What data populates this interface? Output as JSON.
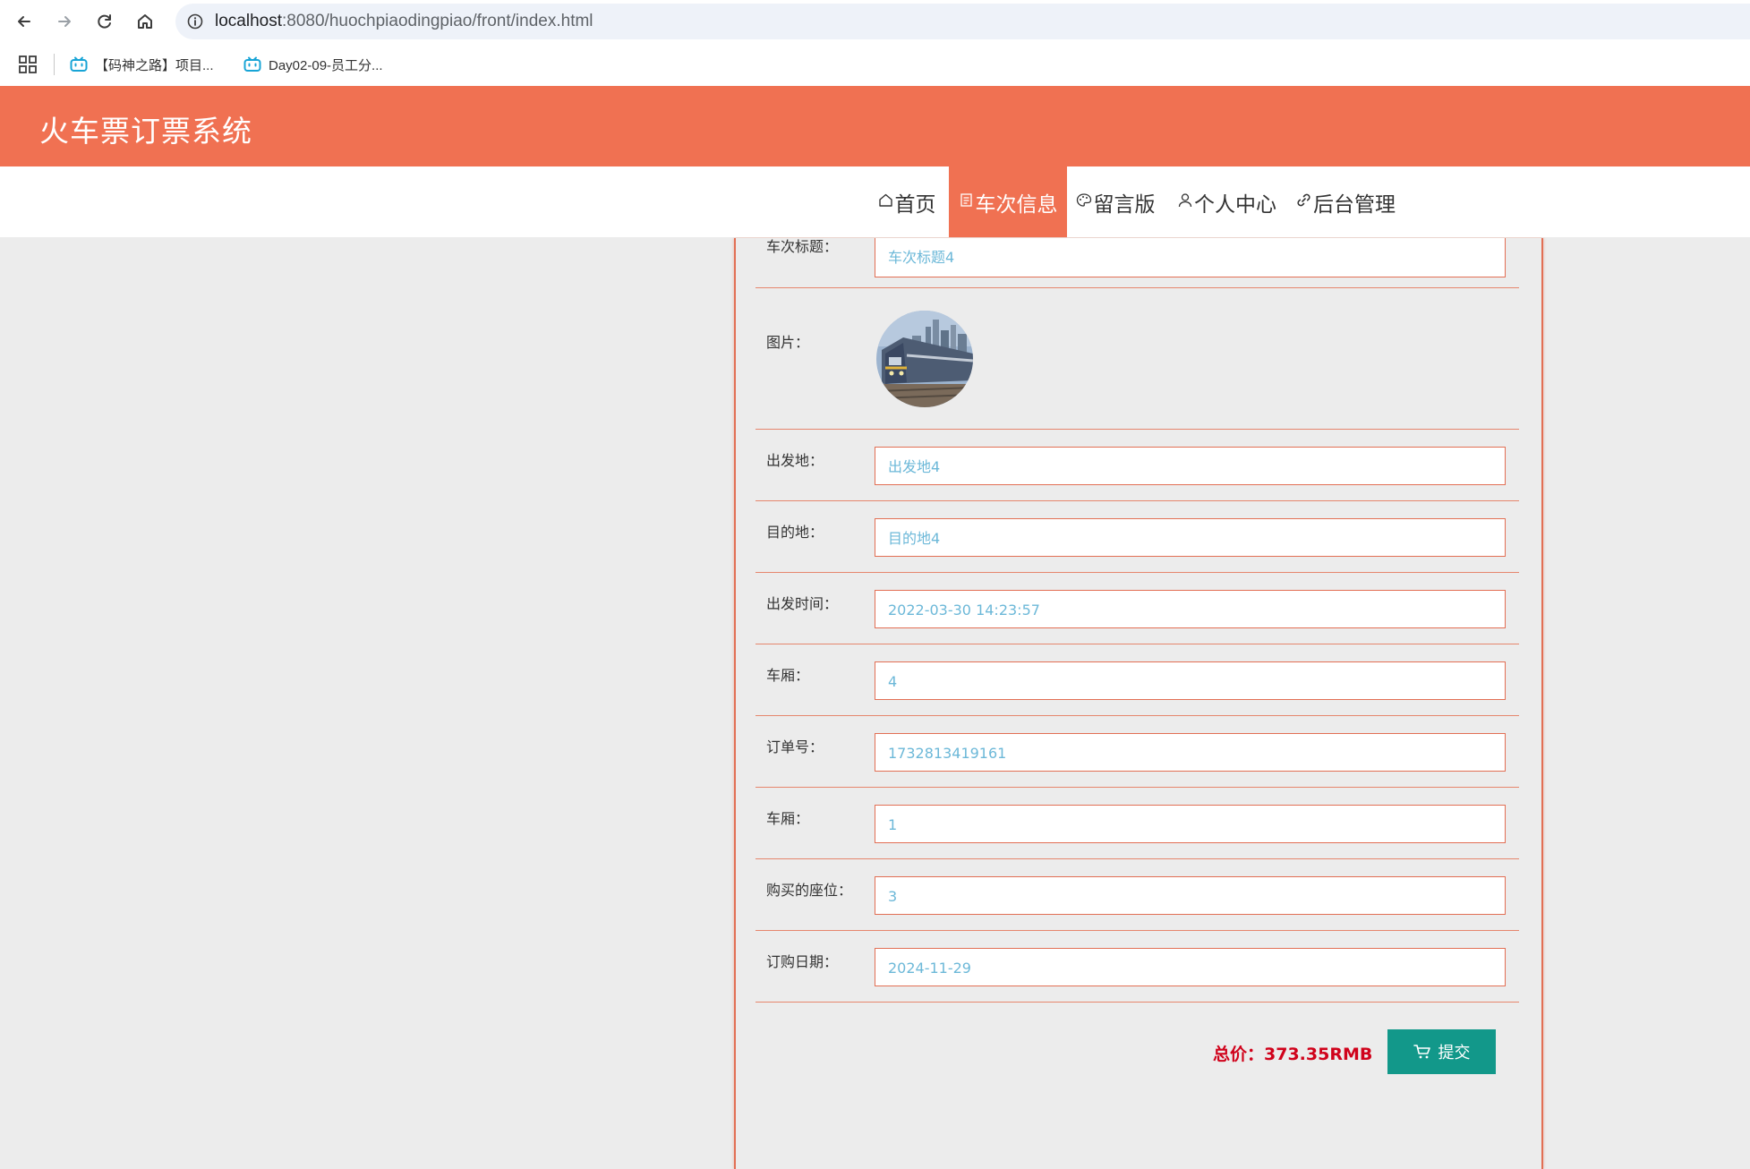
{
  "browser": {
    "url_host": "localhost",
    "url_path": ":8080/huochpiaodingpiao/front/index.html",
    "bookmarks": [
      {
        "label": "【码神之路】项目..."
      },
      {
        "label": "Day02-09-员工分..."
      }
    ]
  },
  "app": {
    "title": "火车票订票系统",
    "brand_color": "#f07152"
  },
  "nav": {
    "items": [
      {
        "label": "首页",
        "icon": "home-icon"
      },
      {
        "label": "车次信息",
        "icon": "document-icon"
      },
      {
        "label": "留言版",
        "icon": "palette-icon"
      },
      {
        "label": "个人中心",
        "icon": "user-icon"
      },
      {
        "label": "后台管理",
        "icon": "link-icon"
      }
    ],
    "active": "车次信息"
  },
  "form": {
    "fields": [
      {
        "label": "车次标题：",
        "value": "车次标题4"
      },
      {
        "label": "图片：",
        "value": ""
      },
      {
        "label": "出发地：",
        "value": "出发地4"
      },
      {
        "label": "目的地：",
        "value": "目的地4"
      },
      {
        "label": "出发时间：",
        "value": "2022-03-30 14:23:57"
      },
      {
        "label": "车厢：",
        "value": "4"
      },
      {
        "label": "订单号：",
        "value": "1732813419161"
      },
      {
        "label": "车厢：",
        "value": "1"
      },
      {
        "label": "购买的座位：",
        "value": "3"
      },
      {
        "label": "订购日期：",
        "value": "2024-11-29"
      }
    ],
    "total_price": "总价：373.35RMB",
    "submit_label": "提交"
  }
}
